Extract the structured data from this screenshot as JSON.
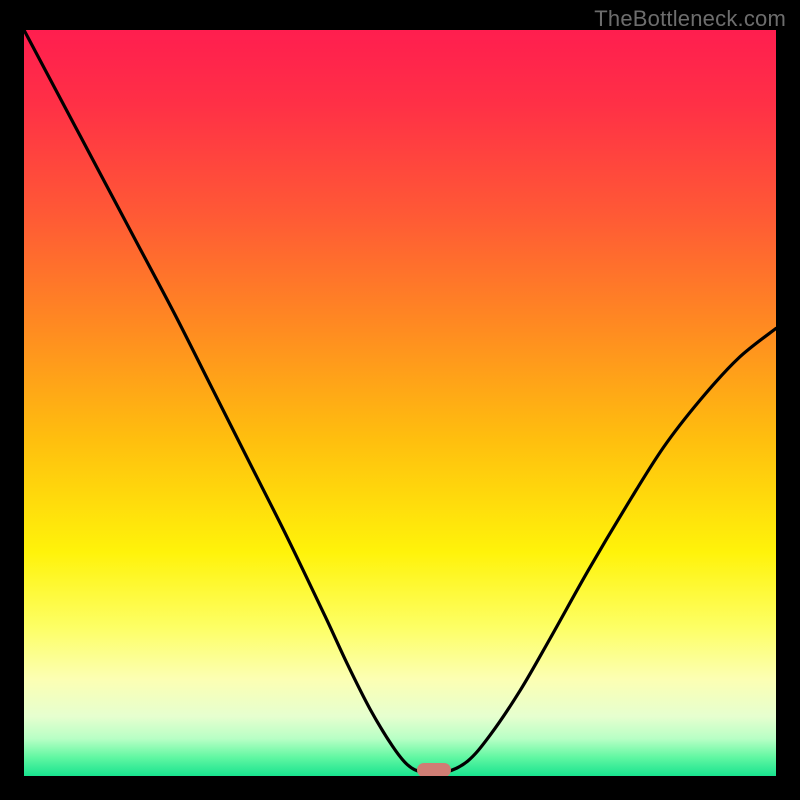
{
  "watermark": "TheBottleneck.com",
  "gradient": {
    "stops": [
      {
        "offset": 0.0,
        "color": "#ff1e4f"
      },
      {
        "offset": 0.1,
        "color": "#ff3046"
      },
      {
        "offset": 0.25,
        "color": "#ff5a35"
      },
      {
        "offset": 0.4,
        "color": "#ff8b21"
      },
      {
        "offset": 0.55,
        "color": "#ffbf0e"
      },
      {
        "offset": 0.7,
        "color": "#fff30a"
      },
      {
        "offset": 0.8,
        "color": "#fdff64"
      },
      {
        "offset": 0.87,
        "color": "#fcffb3"
      },
      {
        "offset": 0.92,
        "color": "#e6ffcf"
      },
      {
        "offset": 0.95,
        "color": "#b8ffc5"
      },
      {
        "offset": 0.975,
        "color": "#61f7a2"
      },
      {
        "offset": 1.0,
        "color": "#18e38f"
      }
    ]
  },
  "marker": {
    "x_frac": 0.545,
    "y_frac": 0.992,
    "color": "#cf7d74"
  },
  "chart_data": {
    "type": "line",
    "title": "",
    "xlabel": "",
    "ylabel": "",
    "xlim": [
      0,
      1
    ],
    "ylim": [
      0,
      1
    ],
    "series": [
      {
        "name": "bottleneck-curve",
        "x": [
          0.0,
          0.05,
          0.1,
          0.15,
          0.2,
          0.25,
          0.3,
          0.35,
          0.4,
          0.43,
          0.46,
          0.49,
          0.51,
          0.53,
          0.56,
          0.59,
          0.62,
          0.66,
          0.7,
          0.75,
          0.8,
          0.85,
          0.9,
          0.95,
          1.0
        ],
        "y": [
          1.0,
          0.905,
          0.81,
          0.715,
          0.62,
          0.52,
          0.42,
          0.32,
          0.215,
          0.15,
          0.09,
          0.04,
          0.015,
          0.005,
          0.005,
          0.02,
          0.055,
          0.115,
          0.185,
          0.275,
          0.36,
          0.44,
          0.505,
          0.56,
          0.6
        ]
      }
    ],
    "minimum_marker": {
      "x": 0.545,
      "y": 0.008,
      "shape": "rounded-rect",
      "color": "#cf7d74"
    }
  }
}
